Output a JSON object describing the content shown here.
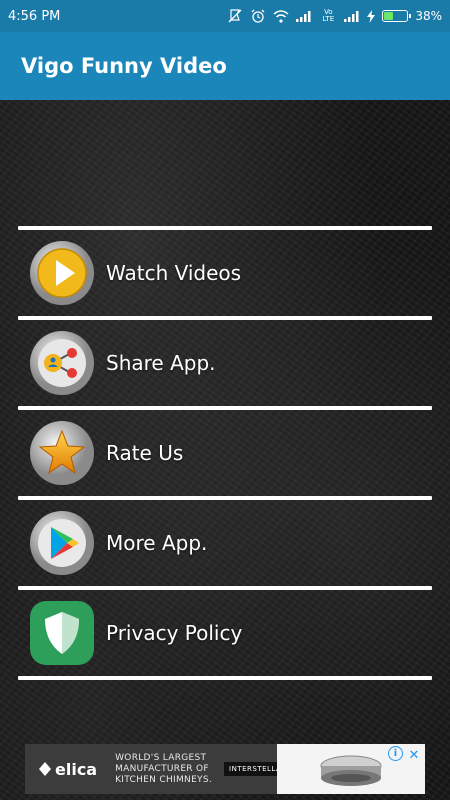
{
  "status_bar": {
    "time": "4:56 PM",
    "battery_percent": "38%",
    "battery_level": 0.38,
    "network_label": "Vo LTE",
    "icons": [
      "mute-icon",
      "alarm-icon",
      "wifi-icon",
      "signal-icon",
      "lte-icon",
      "signal-icon",
      "charging-icon",
      "battery-icon"
    ]
  },
  "app_bar": {
    "title": "Vigo Funny Video"
  },
  "menu": {
    "items": [
      {
        "label": "Watch Videos",
        "icon": "play-icon"
      },
      {
        "label": "Share App.",
        "icon": "share-icon"
      },
      {
        "label": "Rate Us",
        "icon": "star-icon"
      },
      {
        "label": "More App.",
        "icon": "play-store-icon"
      },
      {
        "label": "Privacy Policy",
        "icon": "shield-icon"
      }
    ]
  },
  "ad": {
    "brand": "elica",
    "headline_line1": "WORLD'S LARGEST",
    "headline_line2": "MANUFACTURER OF",
    "headline_line3": "KITCHEN CHIMNEYS.",
    "tag": "INTERSTELLAR",
    "info_glyph": "i",
    "close_glyph": "✕"
  },
  "colors": {
    "status_bar": "#1a7aa8",
    "app_bar": "#1b86ba",
    "divider": "#ffffff",
    "ad_background": "#3c3c3c"
  }
}
